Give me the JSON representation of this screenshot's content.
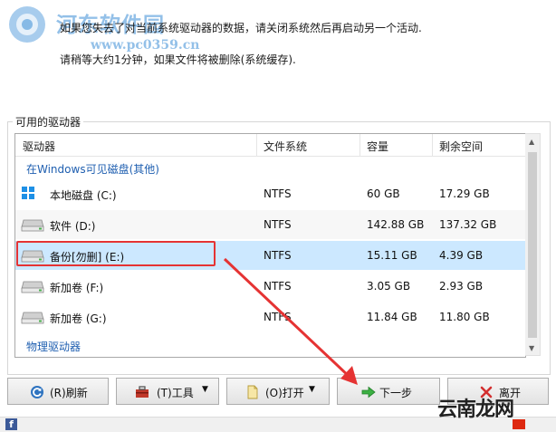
{
  "message": {
    "line1": "如果您失去了对当前系统驱动器的数据，请关闭系统然后再启动另一个活动.",
    "line2": "请稍等大约1分钟，如果文件将被删除(系统缓存)."
  },
  "watermark": {
    "site_name": "河东软件园",
    "site_url": "www.pc0359.cn",
    "corner_text": "云南龙网"
  },
  "group": {
    "title": "可用的驱动器"
  },
  "columns": [
    "驱动器",
    "文件系统",
    "容量",
    "剩余空间"
  ],
  "sections": {
    "visible": "在Windows可见磁盘(其他)",
    "physical": "物理驱动器"
  },
  "drives": [
    {
      "name": "本地磁盘 (C:)",
      "fs": "NTFS",
      "capacity": "60 GB",
      "free": "17.29 GB",
      "icon": "windows-drive-icon"
    },
    {
      "name": "软件 (D:)",
      "fs": "NTFS",
      "capacity": "142.88 GB",
      "free": "137.32 GB",
      "icon": "drive-icon"
    },
    {
      "name": "备份[勿删] (E:)",
      "fs": "NTFS",
      "capacity": "15.11 GB",
      "free": "4.39 GB",
      "icon": "drive-icon"
    },
    {
      "name": "新加卷 (F:)",
      "fs": "NTFS",
      "capacity": "3.05 GB",
      "free": "2.93 GB",
      "icon": "drive-icon"
    },
    {
      "name": "新加卷 (G:)",
      "fs": "NTFS",
      "capacity": "11.84 GB",
      "free": "11.80 GB",
      "icon": "drive-icon"
    }
  ],
  "buttons": {
    "refresh": "(R)刷新",
    "tools": "(T)工具",
    "open": "(O)打开",
    "next": "下一步",
    "exit": "离开"
  },
  "colors": {
    "selection": "#cce8ff",
    "highlight": "#e53333",
    "arrow": "#e53333"
  }
}
